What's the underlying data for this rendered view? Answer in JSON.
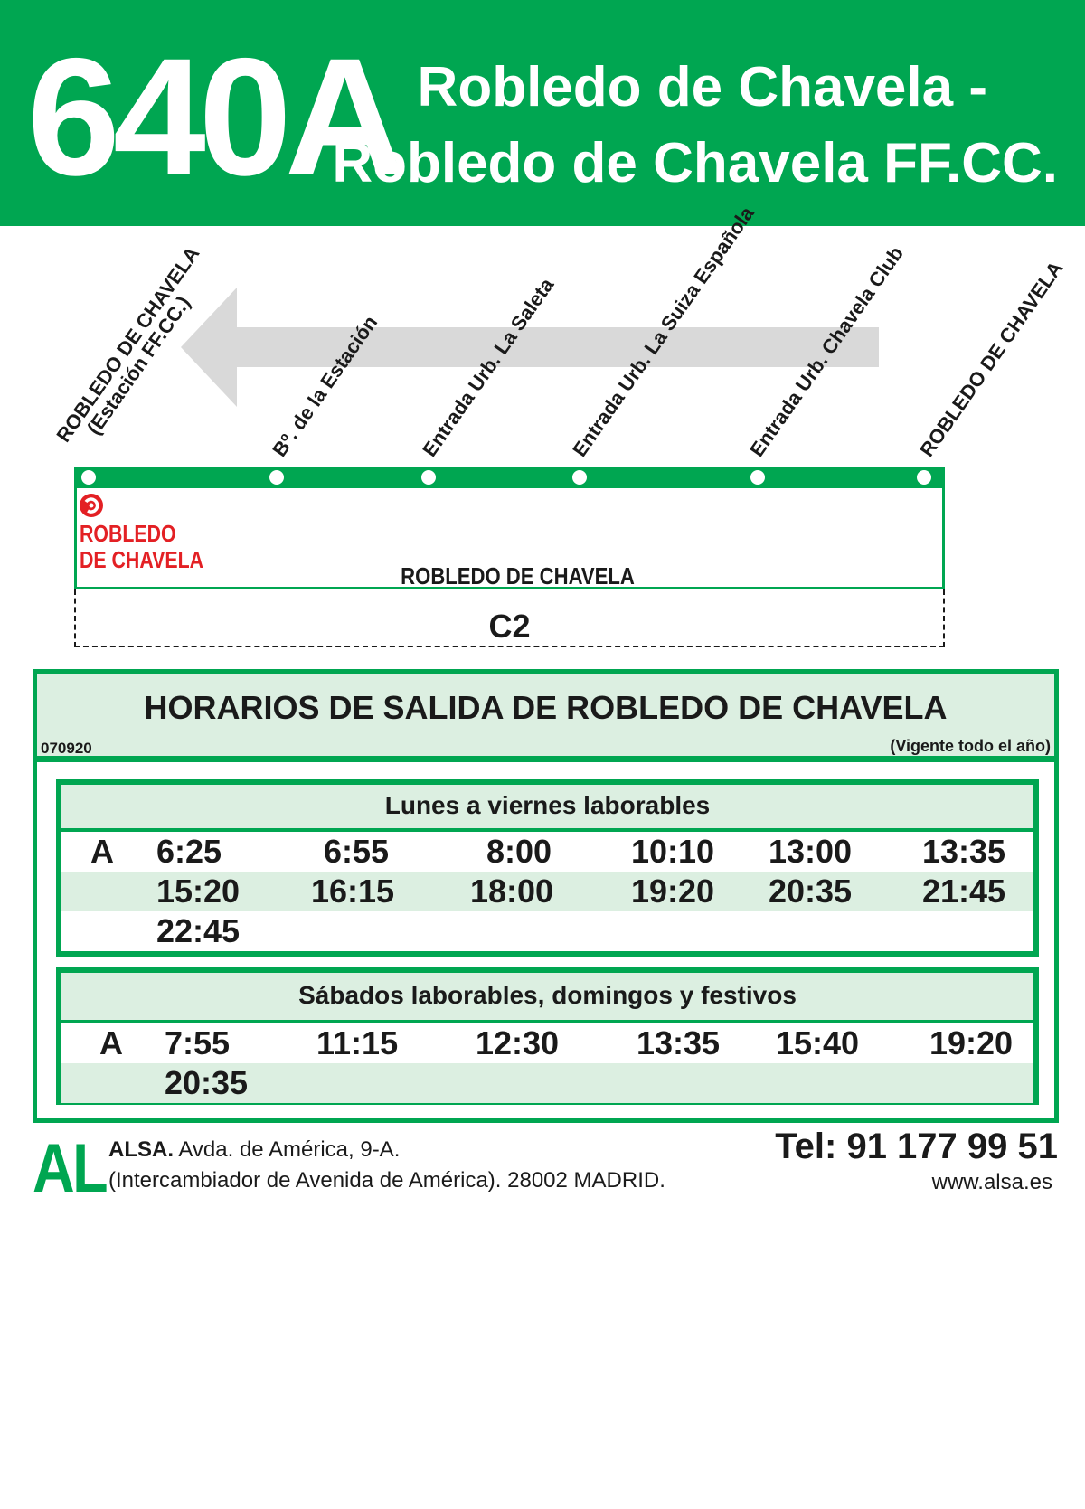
{
  "header": {
    "route_number": "640A",
    "route_line1": "Robledo de Chavela -",
    "route_line2": "Robledo de Chavela FF.CC."
  },
  "diagram": {
    "direction": "right-to-left",
    "stops": [
      {
        "line1": "ROBLEDO DE CHAVELA",
        "line2": "(Estación FF.CC.)"
      },
      {
        "line1": "Bº. de la Estación",
        "line2": ""
      },
      {
        "line1": "Entrada Urb. La Saleta",
        "line2": ""
      },
      {
        "line1": "Entrada Urb. La Suiza Española",
        "line2": ""
      },
      {
        "line1": "Entrada Urb. Chavela Club",
        "line2": ""
      },
      {
        "line1": "ROBLEDO DE CHAVELA",
        "line2": ""
      }
    ],
    "origin_name": "ROBLEDO\nDE CHAVELA",
    "zone_town": "ROBLEDO DE CHAVELA",
    "zone_code": "C2"
  },
  "timetable": {
    "title": "HORARIOS DE SALIDA DE ROBLEDO DE CHAVELA",
    "code": "070920",
    "validity": "(Vigente todo el año)",
    "weekdays": {
      "label": "Lunes a viernes laborables",
      "rows": [
        [
          "A",
          "6:25",
          "6:55",
          "8:00",
          "10:10",
          "13:00",
          "13:35"
        ],
        [
          "",
          "15:20",
          "16:15",
          "18:00",
          "19:20",
          "20:35",
          "21:45"
        ],
        [
          "",
          "22:45",
          "",
          "",
          "",
          "",
          ""
        ]
      ]
    },
    "weekends": {
      "label": "Sábados laborables, domingos y festivos",
      "rows": [
        [
          "A",
          "7:55",
          "11:15",
          "12:30",
          "13:35",
          "15:40",
          "19:20"
        ],
        [
          "",
          "20:35",
          "",
          "",
          "",
          "",
          ""
        ]
      ]
    }
  },
  "footer": {
    "logo": "AL",
    "company": "ALSA.",
    "address1": " Avda. de América, 9-A.",
    "address2": "(Intercambiador de Avenida de América). 28002 MADRID.",
    "phone": "Tel: 91 177 99 51",
    "website": "www.alsa.es"
  },
  "colors": {
    "brand_green": "#00a651",
    "light_green": "#dcefe1",
    "origin_red": "#e32024"
  }
}
